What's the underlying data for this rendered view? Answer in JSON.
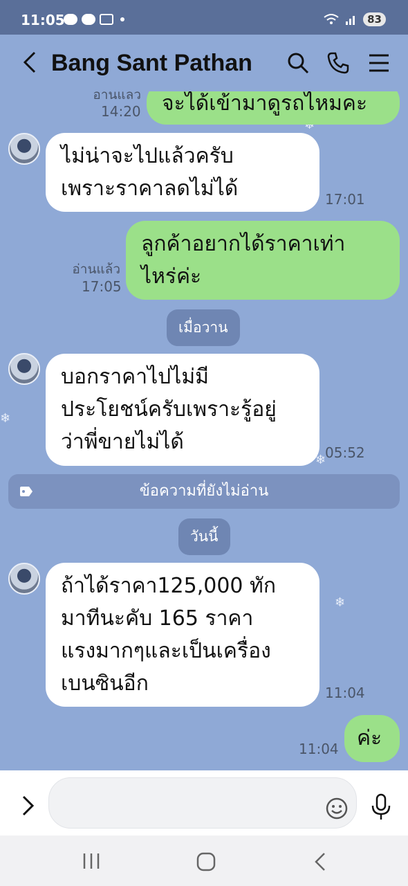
{
  "status_bar": {
    "time": "11:05",
    "battery": "83",
    "icons": [
      "line-app-icon",
      "chat-bubble-icon",
      "screenshot-icon",
      "dot-icon",
      "wifi-icon",
      "signal-icon"
    ]
  },
  "header": {
    "title": "Bang Sant Pathan",
    "back_icon": "chevron-left-icon",
    "search_icon": "search-icon",
    "call_icon": "phone-icon",
    "menu_icon": "menu-icon"
  },
  "messages": [
    {
      "side": "out",
      "text": "จะได้เข้ามาดูรถไหมคะ",
      "read": "อ่านแล้ว",
      "time": "14:20"
    },
    {
      "side": "in",
      "lines": [
        "ไม่น่าจะไปแล้วครับ",
        "เพราะราคาลดไม่ได้"
      ],
      "time": "17:01"
    },
    {
      "side": "out",
      "lines": [
        "ลูกค้าอยากได้ราคาเท่า",
        "ไหร่ค่ะ"
      ],
      "read": "อ่านแล้ว",
      "time": "17:05"
    },
    {
      "side": "in",
      "lines": [
        "บอกราคาไปไม่มี",
        "ประโยชน์ครับเพราะรู้อยู่",
        "ว่าพี่ขายไม่ได้"
      ],
      "time": "05:52"
    },
    {
      "side": "in",
      "lines": [
        "ถ้าได้ราคา125,000 ทัก",
        "มาทีนะคับ 165 ราคา",
        "แรงมากๆและเป็นเครื่อง",
        "เบนซินอีก"
      ],
      "time": "11:04"
    },
    {
      "side": "out",
      "text": "ค่ะ",
      "time": "11:04"
    }
  ],
  "dividers": {
    "yesterday": "เมื่อวาน",
    "unread": "ข้อความที่ยังไม่อ่าน",
    "today": "วันนี้"
  },
  "input": {
    "value": "",
    "placeholder": ""
  },
  "colors": {
    "chat_bg": "#8fa9d6",
    "outgoing_bubble": "#9be089",
    "incoming_bubble": "#ffffff",
    "status_bar": "#5a6f99"
  }
}
